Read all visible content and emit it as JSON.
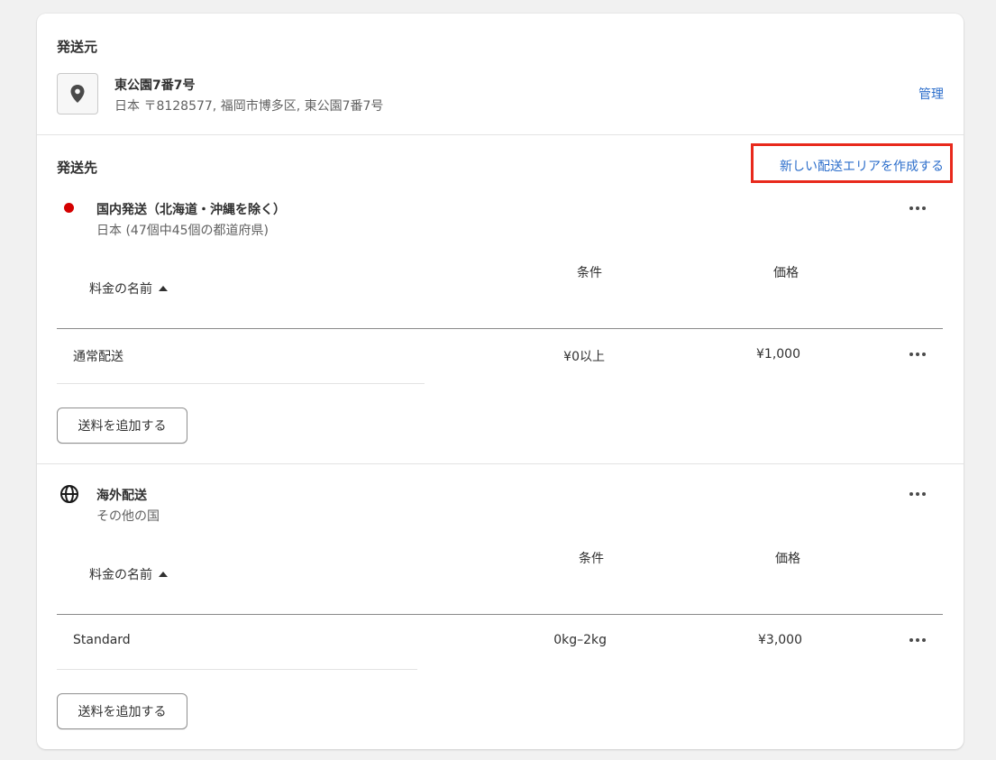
{
  "origin": {
    "title": "発送元",
    "location_name": "東公園7番7号",
    "address": "日本 〒8128577, 福岡市博多区, 東公園7番7号",
    "manage_label": "管理"
  },
  "destination": {
    "title": "発送先",
    "create_zone_label": "新しい配送エリアを作成する"
  },
  "zones": [
    {
      "name": "国内発送（北海道・沖縄を除く）",
      "detail": "日本 (47個中45個の都道府県)",
      "indicator_color": "#d40000",
      "icon": "red-dot",
      "headers": {
        "name": "料金の名前",
        "condition": "条件",
        "price": "価格"
      },
      "rates": [
        {
          "name": "通常配送",
          "condition": "¥0以上",
          "price": "¥1,000"
        }
      ],
      "add_rate_label": "送料を追加する"
    },
    {
      "name": "海外配送",
      "detail": "その他の国",
      "icon": "globe-icon",
      "headers": {
        "name": "料金の名前",
        "condition": "条件",
        "price": "価格"
      },
      "rates": [
        {
          "name": "Standard",
          "condition": "0kg–2kg",
          "price": "¥3,000"
        }
      ],
      "add_rate_label": "送料を追加する"
    }
  ],
  "colors": {
    "link": "#2c6ecb",
    "highlight": "#e8291c",
    "domestic_dot": "#d40000"
  }
}
